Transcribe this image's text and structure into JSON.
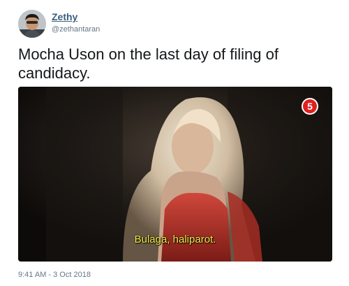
{
  "user": {
    "display_name": "Zethy",
    "handle": "@zethantaran",
    "avatar_icon": "profile-photo"
  },
  "tweet": {
    "text": "Mocha Uson on the last day of filing of candidacy.",
    "timestamp": "9:41 AM - 3 Oct 2018"
  },
  "media": {
    "channel_logo": "5",
    "subtitle": "Bulaga, haliparot.",
    "subtitle_color": "#f3ec44",
    "badge_color": "#e02020"
  },
  "colors": {
    "name": "#3b5e80",
    "meta": "#657786",
    "text": "#14171a"
  }
}
